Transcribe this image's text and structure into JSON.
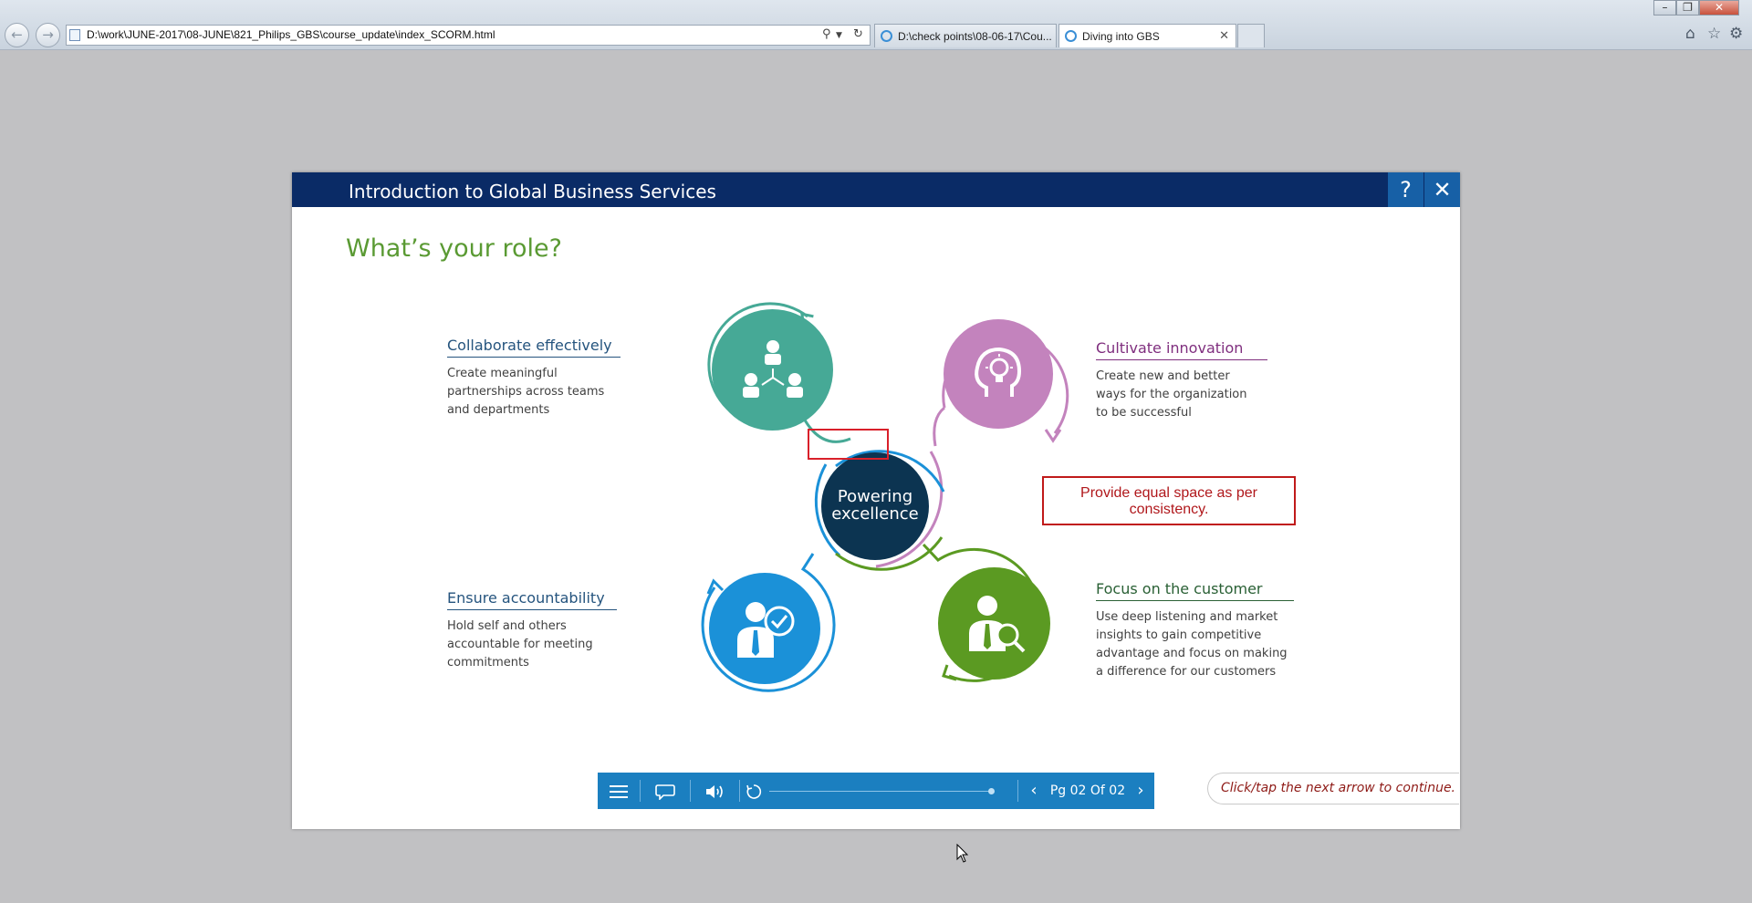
{
  "browser": {
    "address_url": "D:\\work\\JUNE-2017\\08-JUNE\\821_Philips_GBS\\course_update\\index_SCORM.html",
    "tabs": [
      {
        "label": "D:\\check points\\08-06-17\\Cou...",
        "active": false
      },
      {
        "label": "Diving into GBS",
        "active": true
      }
    ],
    "window_controls": [
      "minimize-icon",
      "restore-icon",
      "close-icon"
    ],
    "toolbar_icons": [
      "home-icon",
      "star-icon",
      "gear-icon"
    ]
  },
  "course": {
    "title": "Introduction to Global Business Services",
    "help_label": "?",
    "close_label": "✕",
    "heading": "What’s your role?",
    "center": {
      "line1": "Powering",
      "line2": "excellence",
      "color": "#0c3451"
    },
    "roles": [
      {
        "id": "collaborate",
        "title": "Collaborate effectively",
        "desc_lines": [
          "Create meaningful",
          "partnerships across teams",
          "and departments"
        ],
        "color": "#46a996",
        "title_color": "#25547e",
        "icon": "team-network-icon"
      },
      {
        "id": "innovate",
        "title": "Cultivate innovation",
        "desc_lines": [
          "Create new and better",
          "ways for the organization",
          "to be successful"
        ],
        "color": "#c383bd",
        "title_color": "#7f2e7e",
        "icon": "head-lightbulb-icon"
      },
      {
        "id": "accountability",
        "title": "Ensure accountability",
        "desc_lines": [
          "Hold self and others",
          "accountable for meeting",
          "commitments"
        ],
        "color": "#1b91d8",
        "title_color": "#25547e",
        "icon": "person-check-icon"
      },
      {
        "id": "customer",
        "title": "Focus on the customer",
        "desc_lines": [
          "Use deep listening and market",
          "insights to gain competitive",
          "advantage and focus on making",
          "a difference for our customers"
        ],
        "color": "#5b9a22",
        "title_color": "#2a6035",
        "icon": "person-magnifier-icon"
      }
    ],
    "annotation": {
      "line1": "Provide equal space as per",
      "line2": "consistency."
    },
    "player": {
      "menu_icon": "menu-icon",
      "transcript_icon": "speech-bubble-icon",
      "audio_icon": "speaker-icon",
      "replay_icon": "replay-icon",
      "progress": 1.0,
      "page_label": "Pg 02 Of 02"
    },
    "continue_hint": "Click/tap the next arrow to continue."
  },
  "colors": {
    "header": "#0a2b66",
    "player": "#1b7fc0",
    "heading": "#5a9a33",
    "annotation": "#c01a1a"
  }
}
